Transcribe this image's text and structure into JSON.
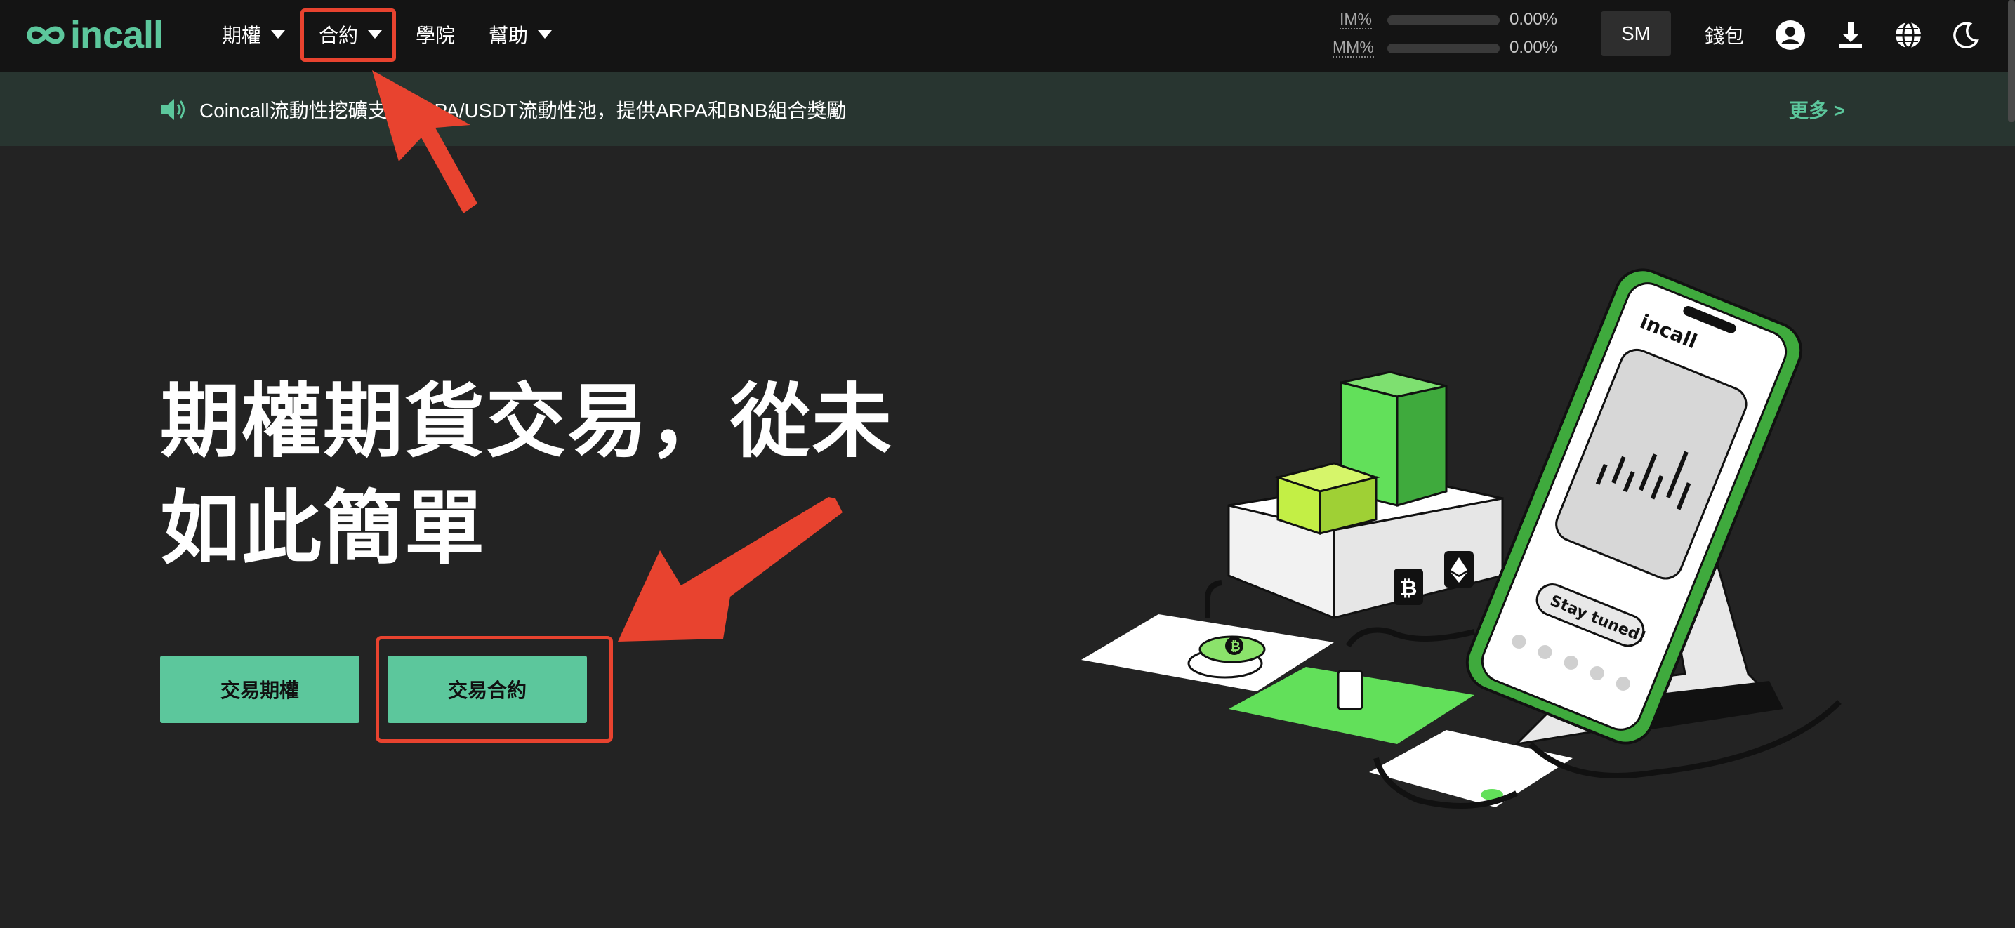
{
  "brand": {
    "logo_text": "incall",
    "accent": "#5cc79c"
  },
  "nav": {
    "items": [
      {
        "label": "期權",
        "has_dropdown": true
      },
      {
        "label": "合約",
        "has_dropdown": true
      },
      {
        "label": "學院",
        "has_dropdown": false
      },
      {
        "label": "幫助",
        "has_dropdown": true
      }
    ]
  },
  "metrics": [
    {
      "label": "IM%",
      "value": "0.00%",
      "progress": 0
    },
    {
      "label": "MM%",
      "value": "0.00%",
      "progress": 0
    }
  ],
  "header": {
    "user_initials": "SM",
    "wallet_label": "錢包",
    "icons": [
      "account-icon",
      "download-icon",
      "globe-icon",
      "moon-icon"
    ]
  },
  "announcement": {
    "text": "Coincall流動性挖礦支持ARPA/USDT流動性池，提供ARPA和BNB組合獎勵",
    "more_label": "更多 >"
  },
  "hero": {
    "line1": "期權期貨交易，從未",
    "line2": "如此簡單",
    "primary_button": "交易期權",
    "secondary_button": "交易合約"
  },
  "illustration": {
    "phone_logo": "incall",
    "phone_button": "Stay tuned!"
  },
  "colors": {
    "background": "#232323",
    "topbar": "#141414",
    "announcement_bg": "#283530",
    "annotation_red": "#e8432f",
    "green": "#5cc79c"
  }
}
